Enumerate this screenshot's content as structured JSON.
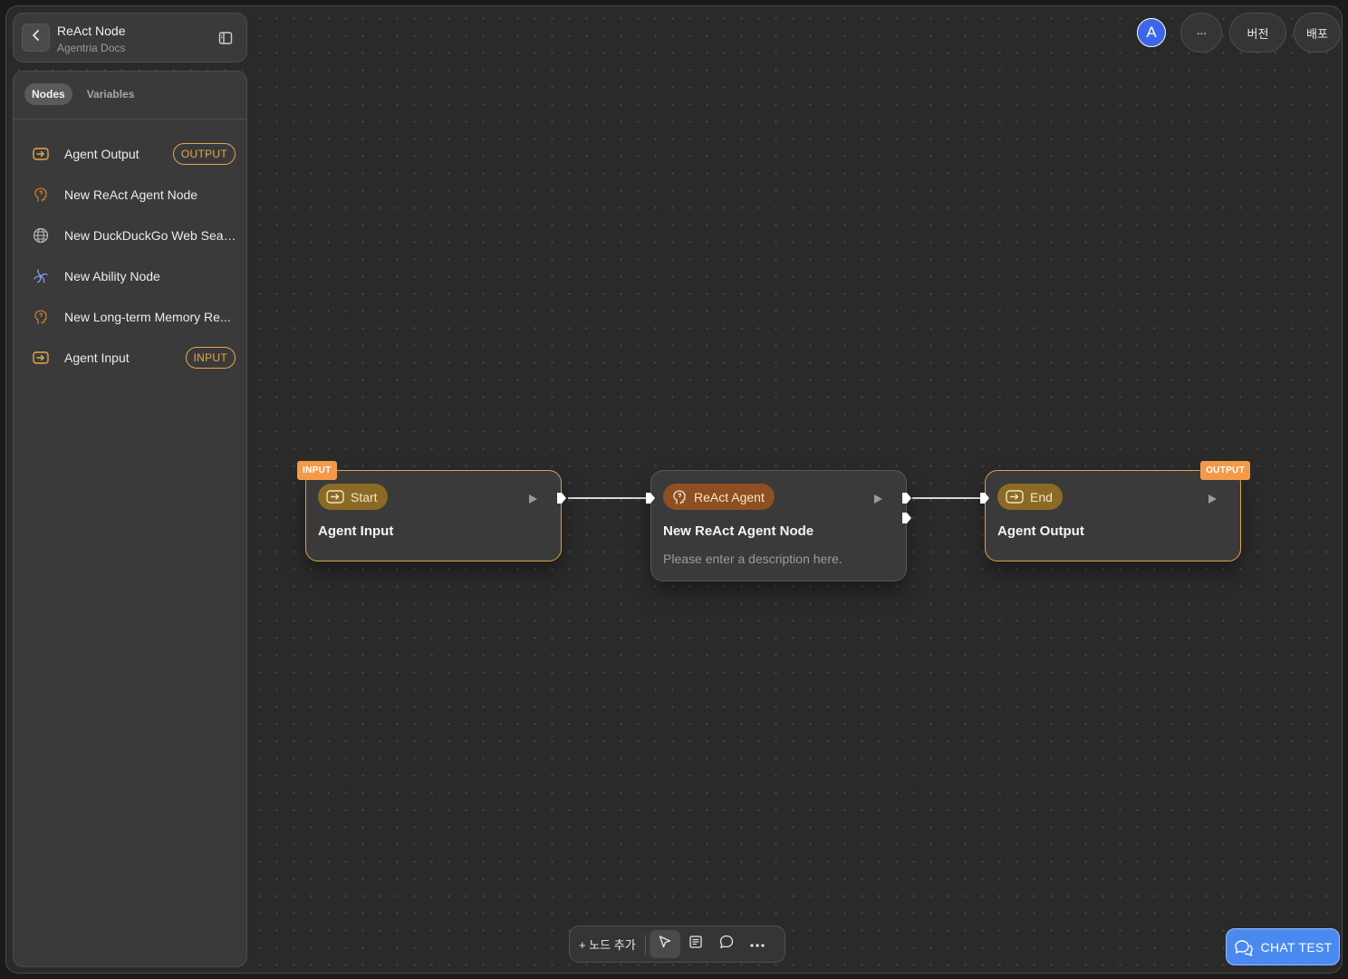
{
  "sidebar": {
    "header": {
      "title": "ReAct Node",
      "subtitle": "Agentria Docs",
      "back_icon": "chevron-left-icon",
      "toggle_icon": "sidebar-toggle-icon"
    },
    "tabs": [
      {
        "label": "Nodes",
        "active": true
      },
      {
        "label": "Variables",
        "active": false
      }
    ],
    "items": [
      {
        "label": "Agent Output",
        "icon": "io-arrow-icon",
        "badge": "OUTPUT"
      },
      {
        "label": "New ReAct Agent Node",
        "icon": "brain-icon",
        "badge": ""
      },
      {
        "label": "New DuckDuckGo Web Sear...",
        "icon": "globe-icon",
        "badge": ""
      },
      {
        "label": "New Ability Node",
        "icon": "ability-icon",
        "badge": ""
      },
      {
        "label": "New Long-term Memory Re...",
        "icon": "brain-icon",
        "badge": ""
      },
      {
        "label": "Agent Input",
        "icon": "io-arrow-icon",
        "badge": "INPUT"
      }
    ]
  },
  "topbar": {
    "avatar_letter": "A",
    "more_label": "···",
    "version_label": "버전",
    "deploy_label": "배포"
  },
  "canvas": {
    "nodes": [
      {
        "tag": "INPUT",
        "chip": "Start",
        "title": "Agent Input",
        "description": ""
      },
      {
        "tag": "",
        "chip": "ReAct Agent",
        "title": "New ReAct Agent Node",
        "description": "Please enter a description here."
      },
      {
        "tag": "OUTPUT",
        "chip": "End",
        "title": "Agent Output",
        "description": ""
      }
    ]
  },
  "toolbar": {
    "add_node_label": "+ 노드 추가",
    "tools": [
      "pointer-icon",
      "note-icon",
      "comment-icon",
      "more-icon"
    ]
  },
  "chat_test": {
    "label": "CHAT TEST",
    "icon": "chat-bubble-icon"
  },
  "colors": {
    "accent_gold": "#e0a14a",
    "tag_orange": "#f29a4a",
    "chat_blue": "#4a8af0",
    "avatar_blue": "#3b66e8"
  }
}
